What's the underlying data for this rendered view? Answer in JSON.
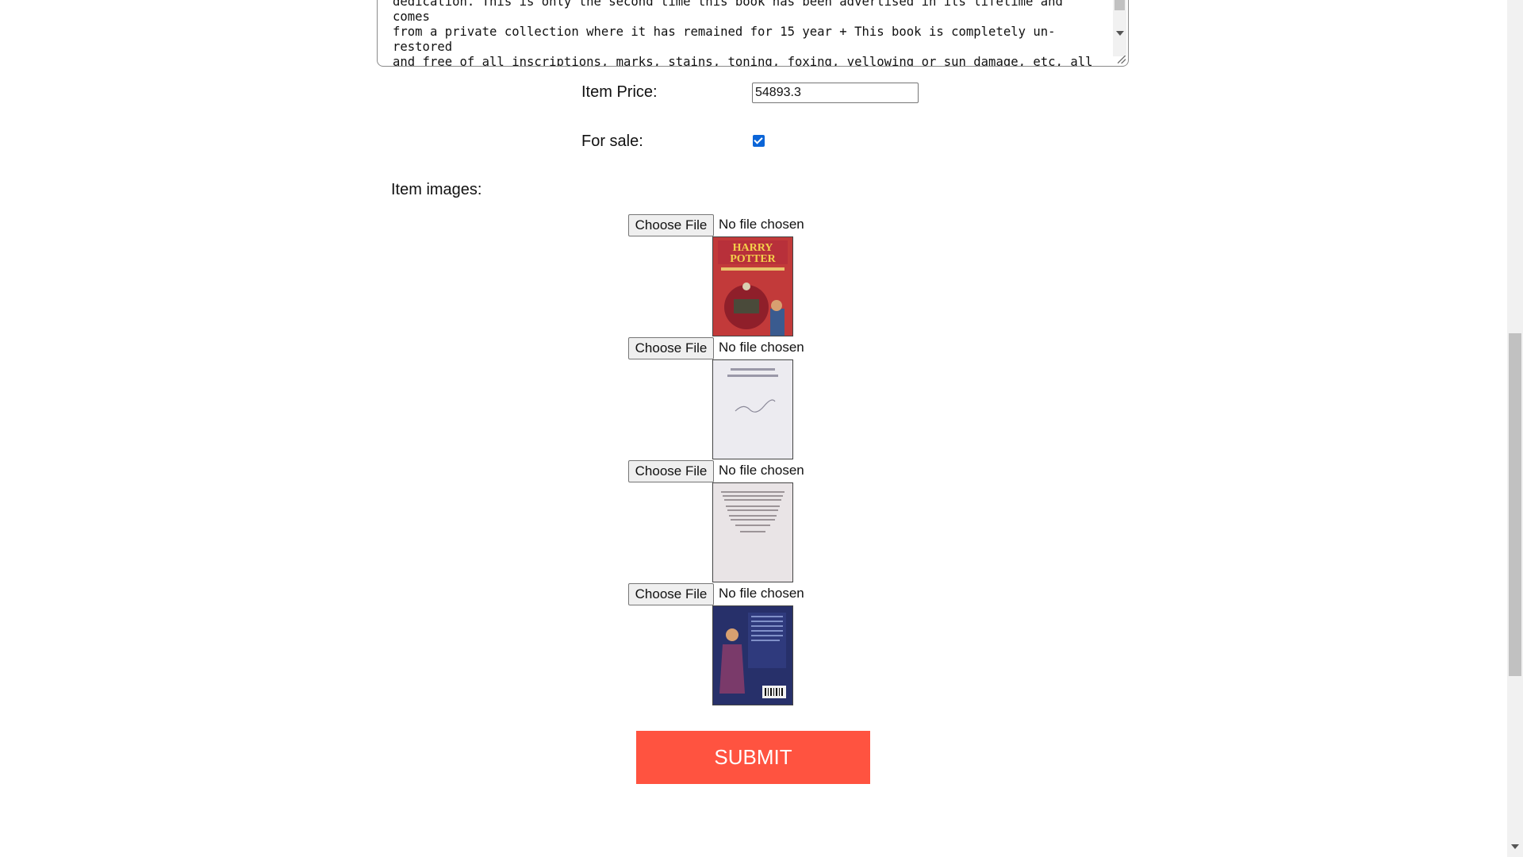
{
  "description": {
    "text": "dedication. This is only the second time this book has been advertised in its lifetime and comes\nfrom a private collection where it has remained for 15 year + This book is completely un-restored\nand free of all inscriptions, marks, stains, toning, foxing, yellowing or sun damage, etc, all\ncommonly found with other examples of this book. Further high-resolution images are available\nupon request. All true first edition points noted and present in this copy. Wendy Cooling quote"
  },
  "price": {
    "label": "Item Price:",
    "value": "54893.3"
  },
  "for_sale": {
    "label": "For sale:",
    "checked": true
  },
  "images": {
    "label": "Item images:",
    "rows": [
      {
        "button": "Choose File",
        "status": "No file chosen",
        "thumb": "book-cover-icon"
      },
      {
        "button": "Choose File",
        "status": "No file chosen",
        "thumb": "signed-title-page-icon"
      },
      {
        "button": "Choose File",
        "status": "No file chosen",
        "thumb": "copyright-page-icon"
      },
      {
        "button": "Choose File",
        "status": "No file chosen",
        "thumb": "back-cover-icon"
      }
    ]
  },
  "submit": {
    "label": "SUBMIT",
    "color": "#ff5340"
  }
}
